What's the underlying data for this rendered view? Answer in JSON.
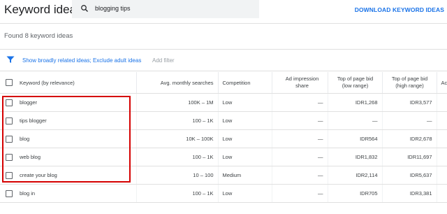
{
  "header": {
    "title": "Keyword ideas",
    "search_value": "blogging tips",
    "download_label": "DOWNLOAD KEYWORD IDEAS"
  },
  "summary": {
    "found_text": "Found 8 keyword ideas"
  },
  "filters": {
    "active_text": "Show broadly related ideas; Exclude adult ideas",
    "add_filter_label": "Add filter"
  },
  "table": {
    "columns": [
      "Keyword (by relevance)",
      "Avg. monthly searches",
      "Competition",
      "Ad impression share",
      "Top of page bid (low range)",
      "Top of page bid (high range)",
      "Acc"
    ],
    "rows": [
      {
        "keyword": "blogger",
        "searches": "100K – 1M",
        "competition": "Low",
        "impression": "—",
        "bid_low": "IDR1,268",
        "bid_high": "IDR3,577"
      },
      {
        "keyword": "tips blogger",
        "searches": "100 – 1K",
        "competition": "Low",
        "impression": "—",
        "bid_low": "—",
        "bid_high": "—"
      },
      {
        "keyword": "blog",
        "searches": "10K – 100K",
        "competition": "Low",
        "impression": "—",
        "bid_low": "IDR564",
        "bid_high": "IDR2,678"
      },
      {
        "keyword": "web blog",
        "searches": "100 – 1K",
        "competition": "Low",
        "impression": "—",
        "bid_low": "IDR1,832",
        "bid_high": "IDR11,697"
      },
      {
        "keyword": "create your blog",
        "searches": "10 – 100",
        "competition": "Medium",
        "impression": "—",
        "bid_low": "IDR2,114",
        "bid_high": "IDR5,637"
      },
      {
        "keyword": "blog in",
        "searches": "100 – 1K",
        "competition": "Low",
        "impression": "—",
        "bid_low": "IDR705",
        "bid_high": "IDR3,381"
      }
    ]
  },
  "colors": {
    "accent": "#1a73e8",
    "highlight": "#d50000"
  }
}
